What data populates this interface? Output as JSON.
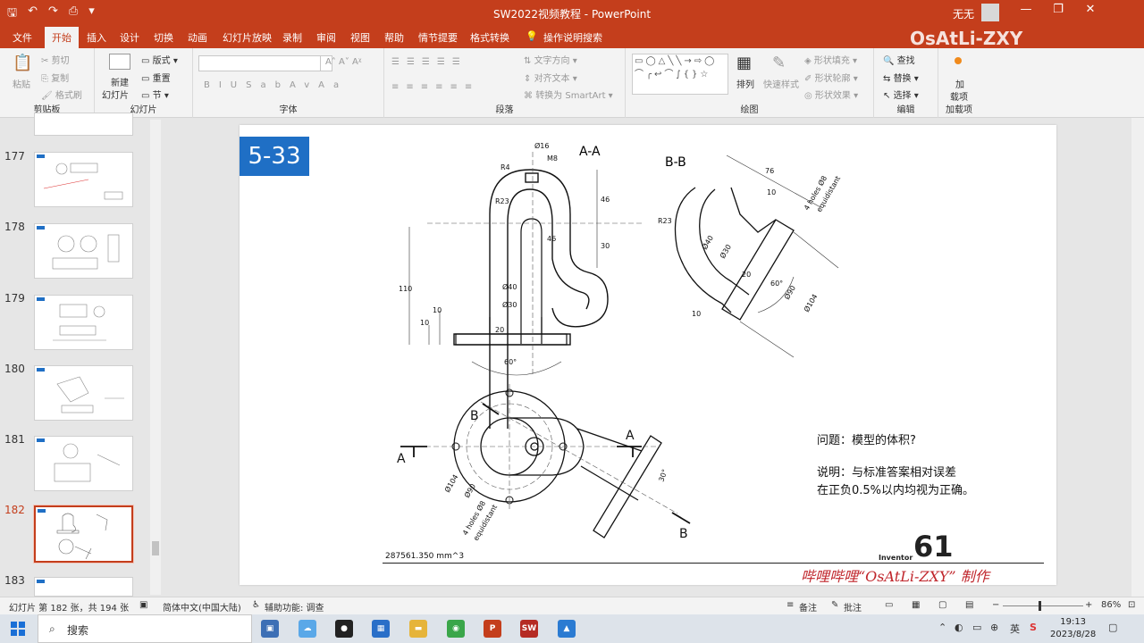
{
  "titlebar": {
    "title": "SW2022视频教程  -  PowerPoint",
    "user": "无无",
    "qat": [
      "🖫",
      "↶",
      "↷",
      "⎙",
      "▾"
    ],
    "window_buttons": [
      "—",
      "❐",
      "✕"
    ]
  },
  "tabs": [
    {
      "label": "文件"
    },
    {
      "label": "开始",
      "active": true
    },
    {
      "label": "插入"
    },
    {
      "label": "设计"
    },
    {
      "label": "切换"
    },
    {
      "label": "动画"
    },
    {
      "label": "幻灯片放映"
    },
    {
      "label": "录制"
    },
    {
      "label": "审阅"
    },
    {
      "label": "视图"
    },
    {
      "label": "帮助"
    },
    {
      "label": "情节提要"
    },
    {
      "label": "格式转换"
    },
    {
      "label": "操作说明搜索"
    }
  ],
  "watermark": "OsAtLi-ZXY",
  "ribbon": {
    "clipboard": {
      "label": "剪贴板",
      "paste": "粘贴",
      "cut": "剪切",
      "copy": "复制",
      "format_painter": "格式刷"
    },
    "slides": {
      "label": "幻灯片",
      "new_slide": "新建",
      "new_slide2": "幻灯片",
      "layout": "版式",
      "reset": "重置",
      "section": "节"
    },
    "font": {
      "label": "字体"
    },
    "paragraph": {
      "label": "段落",
      "text_direction": "文字方向",
      "align_text": "对齐文本",
      "smartart": "转换为 SmartArt"
    },
    "drawing": {
      "label": "绘图",
      "arrange": "排列",
      "quick_styles": "快速样式",
      "shape_fill": "形状填充",
      "shape_outline": "形状轮廓",
      "shape_effects": "形状效果"
    },
    "editing": {
      "label": "编辑",
      "find": "查找",
      "replace": "替换",
      "select": "选择"
    },
    "addins": {
      "label": "加载项",
      "addin1": "加",
      "addin2": "载项"
    }
  },
  "slides_panel": {
    "items": [
      {
        "num": "177"
      },
      {
        "num": "178"
      },
      {
        "num": "179"
      },
      {
        "num": "180"
      },
      {
        "num": "181"
      },
      {
        "num": "182",
        "active": true
      },
      {
        "num": "183"
      }
    ]
  },
  "slide": {
    "badge": "5-33",
    "question": "问题：模型的体积?",
    "note_line1": "说明：与标准答案相对误差",
    "note_line2": "在正负0.5%以内均视为正确。",
    "volume": "287561.350 mm^3",
    "inventor_label": "Inventor",
    "inventor_number": "61",
    "credit": "哔哩哔哩“OsAtLi-ZXY” 制作",
    "drawing": {
      "section_aa": "A-A",
      "section_bb": "B-B",
      "arrow_a": "A",
      "arrow_b": "B",
      "dims": {
        "d16": "Ø16",
        "m8": "M8",
        "r4": "R4",
        "r23": "R23",
        "d46": "46",
        "d46b": "46",
        "d30v": "30",
        "d110": "110",
        "d10a": "10",
        "d10b": "10",
        "d40": "Ø40",
        "d30": "Ø30",
        "d20": "20",
        "a60": "60°",
        "bb_r23": "R23",
        "bb_76": "76",
        "bb_10": "10",
        "bb_holes": "4 holes Ø8",
        "bb_equi": "equidistant",
        "bb_d40": "Ø40",
        "bb_d30": "Ø30",
        "bb_20": "20",
        "bb_60": "60°",
        "bb_d90": "Ø90",
        "bb_d104": "Ø104",
        "bb_10b": "10",
        "top_d104": "Ø104",
        "top_d90": "Ø90",
        "top_holes": "4 holes Ø8",
        "top_equi": "equidistant",
        "top_30": "30°"
      }
    }
  },
  "statusbar": {
    "slide_info": "幻灯片 第 182 张，共 194 张",
    "language": "简体中文(中国大陆)",
    "accessibility": "辅助功能: 调查",
    "notes": "备注",
    "comments": "批注",
    "zoom": "86%"
  },
  "taskbar": {
    "search": "搜索",
    "time": "19:13",
    "date": "2023/8/28",
    "ime": "英"
  },
  "colors": {
    "accent": "#c43e1c",
    "badge": "#1f6fc5",
    "credit": "#c0262c"
  }
}
